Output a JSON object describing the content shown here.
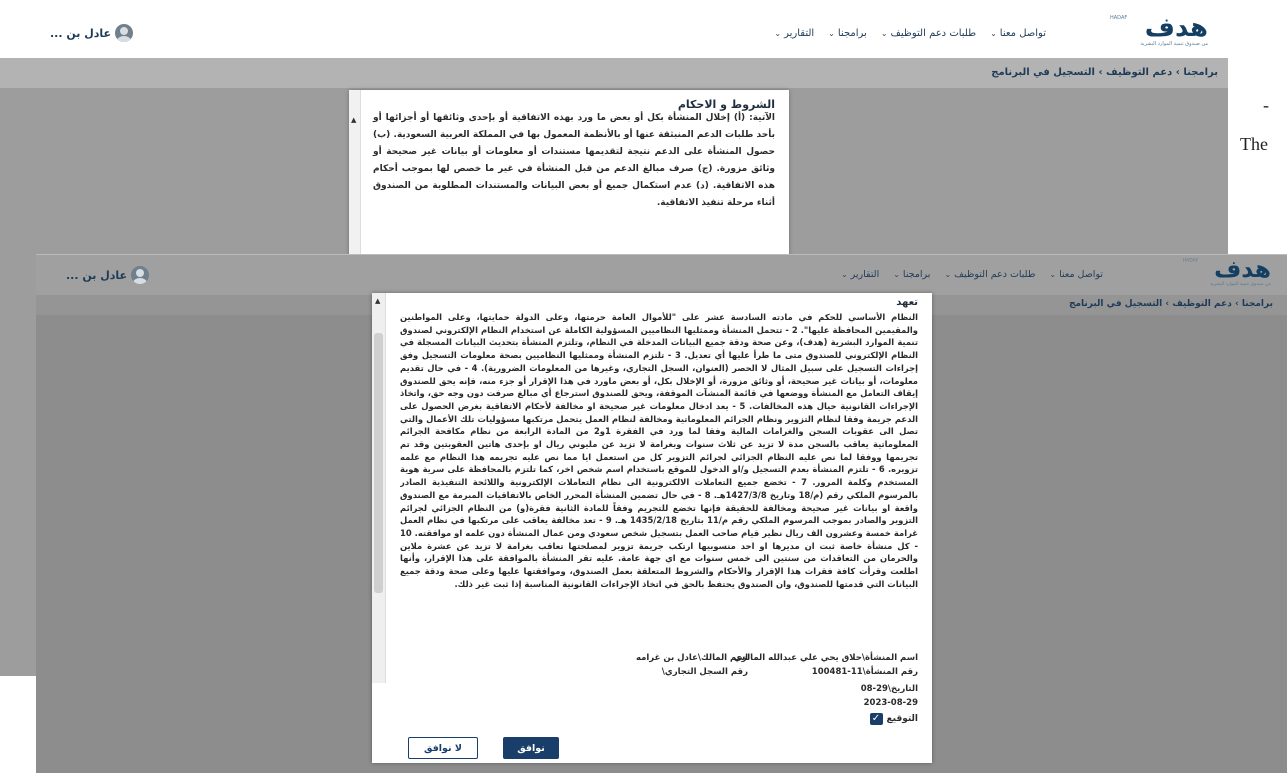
{
  "side_text": {
    "dash": "-",
    "the": "The"
  },
  "header": {
    "logo_text": "هدف",
    "logo_sub": "من صندوق تنمية الموارد البشرية",
    "logo_tiny": "HADAF",
    "nav": [
      {
        "label": "تواصل معنا"
      },
      {
        "label": "طلبات دعم التوظيف"
      },
      {
        "label": "برامجنا"
      },
      {
        "label": "التقارير"
      }
    ],
    "chevron": "⌄",
    "user_name": "عادل بن ..."
  },
  "breadcrumb": "برامجنا › دعم التوظيف › التسجيل في البرنامج",
  "back_modal": {
    "title": "الشروط و الاحكام",
    "body": "الآتية: (أ) إخلال المنشأة بكل أو بعض ما ورد بهذه الاتفاقية أو بإحدى وثائقها أو أجزائها أو بأحد طلبات الدعم المنبثقة عنها أو بالأنظمة المعمول بها في المملكة العربية السعودية. (ب) حصول المنشأة على الدعم نتيجة لتقديمها مستندات أو معلومات أو بيانات غير صحيحة أو وثائق مزورة. (ج) صرف مبالغ الدعم من قبل المنشأة في غير ما خصص لها بموجب أحكام هذه الاتفاقية. (د) عدم استكمال جميع أو بعض البيانات والمستندات المطلوبة من الصندوق أثناء مرحلة تنفيذ الاتفاقية."
  },
  "front_modal": {
    "title": "تعهد",
    "body": "النظام الأساسي للحكم في مادته السادسة عشر على \"للأموال العامة حرمتها، وعلى الدولة حمايتها، وعلى المواطنين والمقيمين المحافظة عليها\". 2 - تتحمل المنشأة وممثليها النظاميين المسؤولية الكاملة عن استخدام النظام الإلكتروني لصندوق تنمية الموارد البشرية (هدف)، وعن صحة ودقة جميع البيانات المدخلة في النظام، وتلتزم المنشأة بتحديث البيانات المسجلة في النظام الإلكتروني للصندوق متى ما طرأ عليها أي تعديل. 3 - تلتزم المنشأة وممثليها النظاميين بصحة معلومات التسجيل وفق إجراءات التسجيل على سبيل المثال لا الحصر (العنوان، السجل التجاري، وغيرها من المعلومات الضرورية). 4 - في حال تقديم معلومات، أو بيانات غير صحيحة، أو وثائق مزورة، أو الإخلال بكل، أو بعض ماورد في هذا الإقرار أو جزء منه، فإنه يحق للصندوق إيقاف التعامل مع المنشأة ووضعها في قائمة المنشآت الموقفة، ويحق للصندوق استرجاع أي مبالغ صرفت دون وجه حق، واتخاذ الإجراءات القانونية حيال هذه المخالفات. 5 - يعد ادخال معلومات غير صحيحة او مخالفة لأحكام الاتفاقية بغرض الحصول على الدعم جريمة وفقا لنظام التزوير ونظام الجرائم المعلوماتية ومخالفة لنظام العمل يتحمل مرتكبها مسؤوليات تلك الأعمال والتي تصل الى عقوبات السجن والغرامات المالية وفقا لما ورد في الفقرة 1و2 من المادة الرابعة من نظام مكافحة الجرائم المعلوماتية يعاقب بالسجن مدة لا تزيد عن ثلاث سنوات وبغرامة لا تزيد عن مليوني ريال او بإحدى هاتين العقوبتين وقد تم تجريمها ووفقا لما نص عليه النظام الجزائي لجرائم التزوير كل من استعمل ايا مما نص عليه تجريمه هذا النظام مع علمه تزويره. 6 - تلتزم المنشأة بعدم التسجيل و/او الدخول للموقع باستخدام اسم شخص اخر، كما تلتزم بالمحافظة على سرية هوية المستخدم وكلمة المرور. 7 - تخضع جميع التعاملات الالكترونية الى نظام التعاملات الإلكترونية واللائحة التنفيذية الصادر بالمرسوم الملكي رقم (م/18 وتاريخ 1427/3/8هـ. 8 - في حال تضمين المنشأة المحرر الخاص بالاتفاقيات المبرمة مع الصندوق واقعة او بيانات غير صحيحة ومخالفة للحقيقة فإنها تخضع للتجريم وفقاً للمادة الثانية فقرة(و) من النظام الجزائي لجرائم التزوير والصادر بموجب المرسوم الملكي رقم م/11 بتاريخ 1435/2/18 هـ. 9 - تعد مخالفة يعاقب على مرتكبها في نظام العمل غرامة خمسة وعشرون الف ريال نظير قيام صاحب العمل بتسجيل شخص سعودي ومن عمال المنشأة دون علمه او موافقته. 10 - كل منشأة خاصة ثبت ان مديرها او احد منسوبيها ارتكب جريمة تزوير لمصلحتها تعاقب بغرامة لا تزيد عن عشرة ملاين والحرمان من التعاقدات من سنتين الى خمس سنوات مع اي جهة عامة. عليه تقر المنشأة بالموافقة على هذا الإقرار، وأنها اطلعت وقرأت كافة فقرات هذا الإقرار والأحكام والشروط المتعلقة بعمل الصندوق، وموافقتها عليها وعلى صحة ودقة جميع البيانات التي قدمتها للصندوق، وان الصندوق يحتفظ بالحق في اتخاذ الإجراءات القانونية المناسبة إذا ثبت غير ذلك.",
    "owner_label": "اسم المنشأة\\حلاق يحي علي عبدالله المالزي",
    "manager_label": "اسم المالك\\عادل بن غرامه",
    "facility_number": "رقم المنشأة\\11-100481",
    "cr_label": "رقم السجل التجاري\\",
    "date_label": "التاريخ\\29-08",
    "date_value": "2023-08-29",
    "checkbox_mark": "✓",
    "signature_label": "التوقيع",
    "agree_button": "نوافق",
    "decline_button": "لا نوافق"
  },
  "scroll_arrow": "▲"
}
